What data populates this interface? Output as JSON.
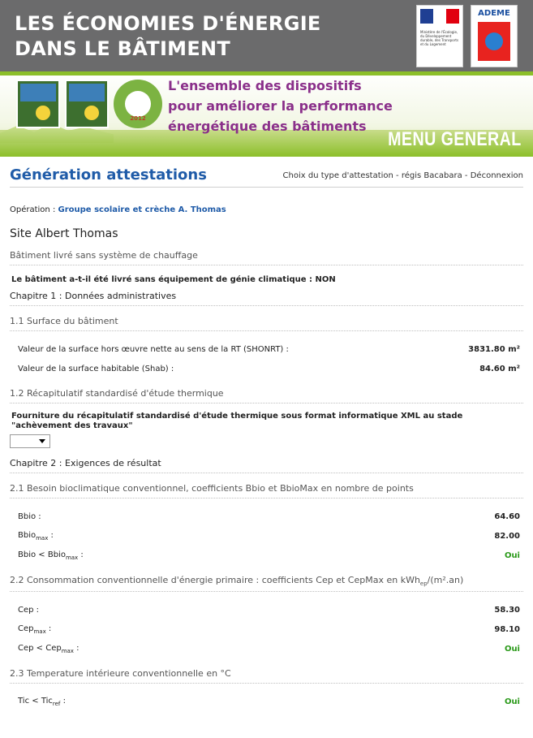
{
  "header": {
    "title_line1": "LES ÉCONOMIES D'ÉNERGIE",
    "title_line2": "DANS LE BÂTIMENT",
    "ministry_text": "Ministère de l'Écologie, du Développement durable, des Transports et du Logement",
    "ademe": "ADEME"
  },
  "banner": {
    "tagline1": "L'ensemble des dispositifs",
    "tagline2": "pour améliorer la performance",
    "tagline3": "énergétique des bâtiments",
    "grenelle_year": "2012",
    "menu": "MENU GENERAL"
  },
  "page": {
    "title": "Génération attestations",
    "nav_choice": "Choix du type d'attestation",
    "nav_user": "régis Bacabara",
    "nav_logout": "Déconnexion",
    "operation_label": "Opération :",
    "operation_value": "Groupe scolaire et crèche A. Thomas",
    "site": "Site Albert Thomas",
    "section_delivered": "Bâtiment livré sans système de chauffage",
    "delivered_question": "Le bâtiment a-t-il été livré sans équipement de génie climatique : NON",
    "chap1": "Chapitre 1 : Données administratives",
    "s11": "1.1 Surface du bâtiment",
    "shonrt_label": "Valeur de la surface hors œuvre nette au sens de la RT (SHONRT) :",
    "shonrt_value": "3831.80 m²",
    "shab_label": "Valeur de la surface habitable (Shab) :",
    "shab_value": "84.60 m²",
    "s12": "1.2 Récapitulatif standardisé d'étude thermique",
    "xml_question": "Fourniture du récapitulatif standardisé d'étude thermique sous format informatique XML au stade \"achèvement des travaux\"",
    "chap2": "Chapitre 2 : Exigences de résultat",
    "s21": "2.1 Besoin bioclimatique conventionnel, coefficients Bbio et BbioMax en nombre de points",
    "bbio_value": "64.60",
    "bbiomax_value": "82.00",
    "bbio_ok": "Oui",
    "s22_pre": "2.2 Consommation conventionnelle d'énergie primaire : coefficients Cep et CepMax en kWh",
    "s22_sub": "ep",
    "s22_post": "/(m².an)",
    "cep_value": "58.30",
    "cepmax_value": "98.10",
    "cep_ok": "Oui",
    "s23": "2.3 Temperature intérieure conventionnelle en °C",
    "tic_ok": "Oui"
  }
}
